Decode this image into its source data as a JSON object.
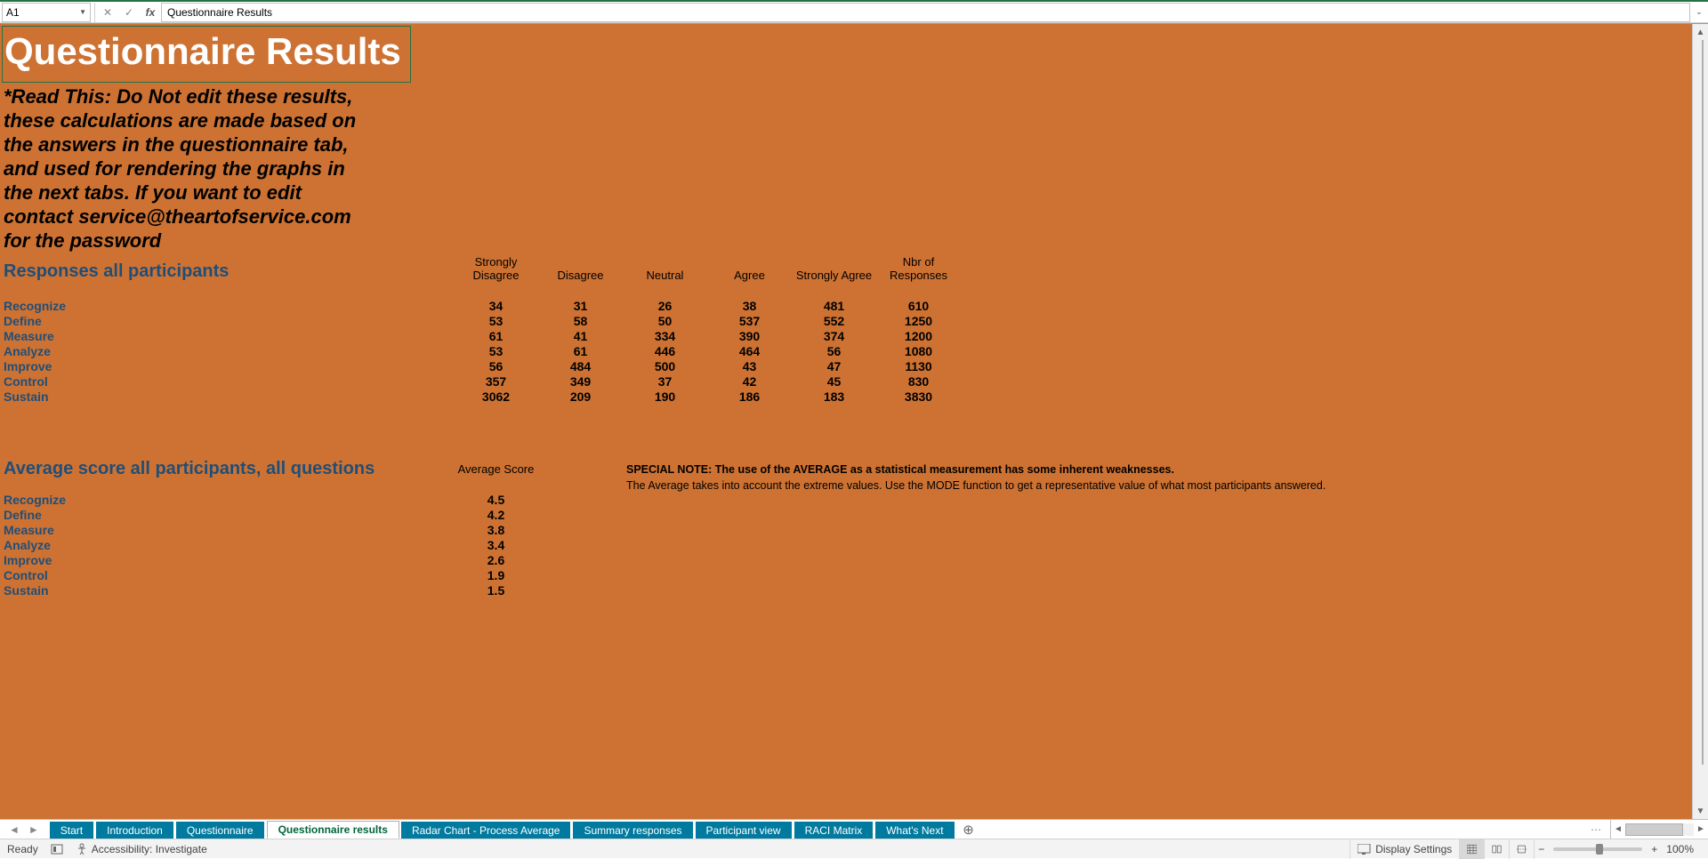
{
  "formula_bar": {
    "cell_ref": "A1",
    "value": "Questionnaire Results"
  },
  "sheet": {
    "title": "Questionnaire Results",
    "warning": "*Read This: Do Not edit these results, these calculations are made based on the answers in the questionnaire tab, and used for rendering the graphs in the next tabs. If you want to edit contact service@theartofservice.com for the password",
    "responses_header": "Responses all participants",
    "columns": {
      "c1a": "Strongly",
      "c1b": "Disagree",
      "c2": "Disagree",
      "c3": "Neutral",
      "c4": "Agree",
      "c5": "Strongly Agree",
      "c6a": "Nbr of",
      "c6b": "Responses"
    },
    "rows": [
      {
        "label": "Recognize",
        "v": [
          "34",
          "31",
          "26",
          "38",
          "481",
          "610"
        ]
      },
      {
        "label": "Define",
        "v": [
          "53",
          "58",
          "50",
          "537",
          "552",
          "1250"
        ]
      },
      {
        "label": "Measure",
        "v": [
          "61",
          "41",
          "334",
          "390",
          "374",
          "1200"
        ]
      },
      {
        "label": "Analyze",
        "v": [
          "53",
          "61",
          "446",
          "464",
          "56",
          "1080"
        ]
      },
      {
        "label": "Improve",
        "v": [
          "56",
          "484",
          "500",
          "43",
          "47",
          "1130"
        ]
      },
      {
        "label": "Control",
        "v": [
          "357",
          "349",
          "37",
          "42",
          "45",
          "830"
        ]
      },
      {
        "label": "Sustain",
        "v": [
          "3062",
          "209",
          "190",
          "186",
          "183",
          "3830"
        ]
      }
    ],
    "avg_header": "Average score all participants, all questions",
    "avg_col": "Average Score",
    "avg_note_bold": "SPECIAL NOTE: The use of the AVERAGE as a statistical measurement has some inherent weaknesses.",
    "avg_note": "The Average takes into account the extreme values. Use the MODE function to get a representative value of what most participants answered.",
    "avg_rows": [
      {
        "label": "Recognize",
        "v": "4.5"
      },
      {
        "label": "Define",
        "v": "4.2"
      },
      {
        "label": "Measure",
        "v": "3.8"
      },
      {
        "label": "Analyze",
        "v": "3.4"
      },
      {
        "label": "Improve",
        "v": "2.6"
      },
      {
        "label": "Control",
        "v": "1.9"
      },
      {
        "label": "Sustain",
        "v": "1.5"
      }
    ]
  },
  "tabs": [
    "Start",
    "Introduction",
    "Questionnaire",
    "Questionnaire results",
    "Radar Chart - Process Average",
    "Summary responses",
    "Participant view",
    "RACI Matrix",
    "What's Next"
  ],
  "active_tab_index": 3,
  "status": {
    "ready": "Ready",
    "accessibility": "Accessibility: Investigate",
    "display_settings": "Display Settings",
    "zoom": "100%"
  }
}
